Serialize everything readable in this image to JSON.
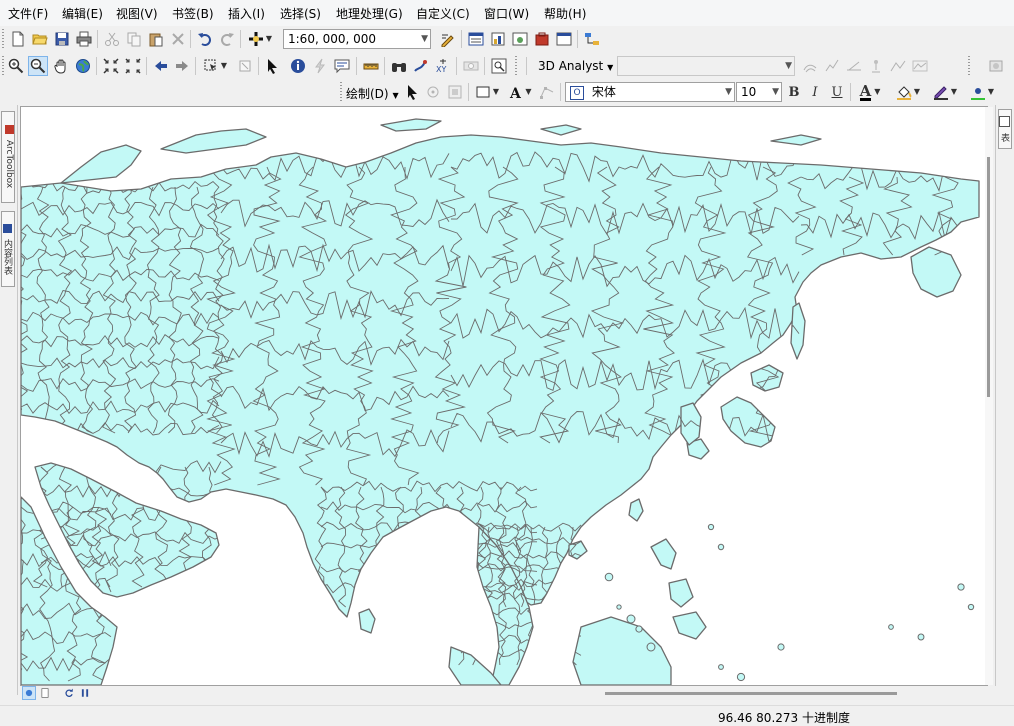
{
  "menubar": {
    "items": [
      "文件(F)",
      "编辑(E)",
      "视图(V)",
      "书签(B)",
      "插入(I)",
      "选择(S)",
      "地理处理(G)",
      "自定义(C)",
      "窗口(W)",
      "帮助(H)"
    ]
  },
  "toolbar_standard": {
    "scale_value": "1:60, 000, 000"
  },
  "toolbar_tools": {
    "analyst_label": "3D Analyst",
    "layer_combo_value": ""
  },
  "toolbar_draw": {
    "draw_label": "绘制(D)",
    "font_name": "宋体",
    "font_size": "10",
    "bold": "B",
    "italic": "I",
    "underline": "U",
    "font_color_glyph": "A"
  },
  "left_dock": {
    "arctoolbox": "ArcToolbox",
    "toc": "内容列表"
  },
  "right_dock": {
    "tab": "表"
  },
  "map": {
    "land_color": "#c3f9f6",
    "border_color": "#6b6b6b",
    "sea_color": "#ffffff"
  },
  "status": {
    "coordinates": "96.46  80.273 十进制度"
  }
}
